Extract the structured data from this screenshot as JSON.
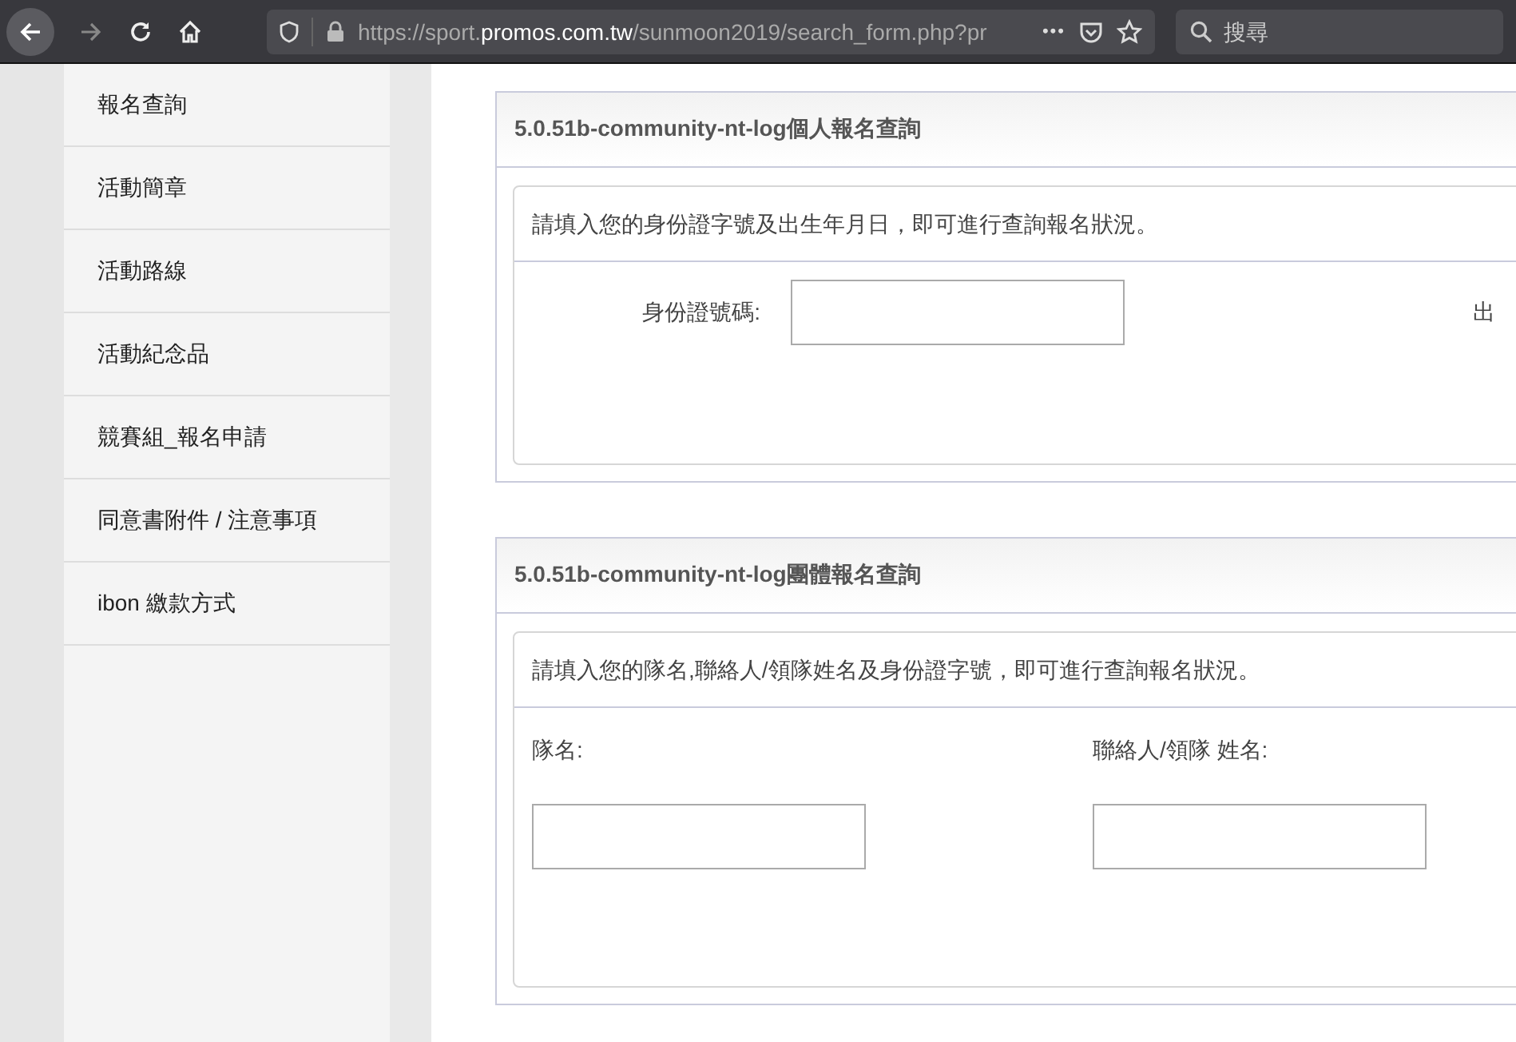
{
  "browser": {
    "url": {
      "scheme_sub": "https://sport.",
      "host": "promos.com.tw",
      "path": "/sunmoon2019/search_form.php?pr"
    },
    "more": "•••",
    "search_placeholder": "搜尋"
  },
  "sidebar": {
    "items": [
      {
        "label": "報名查詢"
      },
      {
        "label": "活動簡章"
      },
      {
        "label": "活動路線"
      },
      {
        "label": "活動紀念品"
      },
      {
        "label": "競賽組_報名申請"
      },
      {
        "label": "同意書附件 / 注意事項"
      },
      {
        "label": "ibon 繳款方式"
      }
    ]
  },
  "panels": [
    {
      "kind": "personal",
      "title": "5.0.51b-community-nt-log個人報名查詢",
      "instruction": "請填入您的身份證字號及出生年月日，即可進行查詢報名狀況。",
      "fields": [
        {
          "label": "身份證號碼:"
        }
      ],
      "cut_label": "出"
    },
    {
      "kind": "group",
      "title": "5.0.51b-community-nt-log團體報名查詢",
      "instruction": "請填入您的隊名,聯絡人/領隊姓名及身份證字號，即可進行查詢報名狀況。",
      "fields": [
        {
          "label": "隊名:"
        },
        {
          "label": "聯絡人/領隊 姓名:"
        }
      ]
    }
  ]
}
